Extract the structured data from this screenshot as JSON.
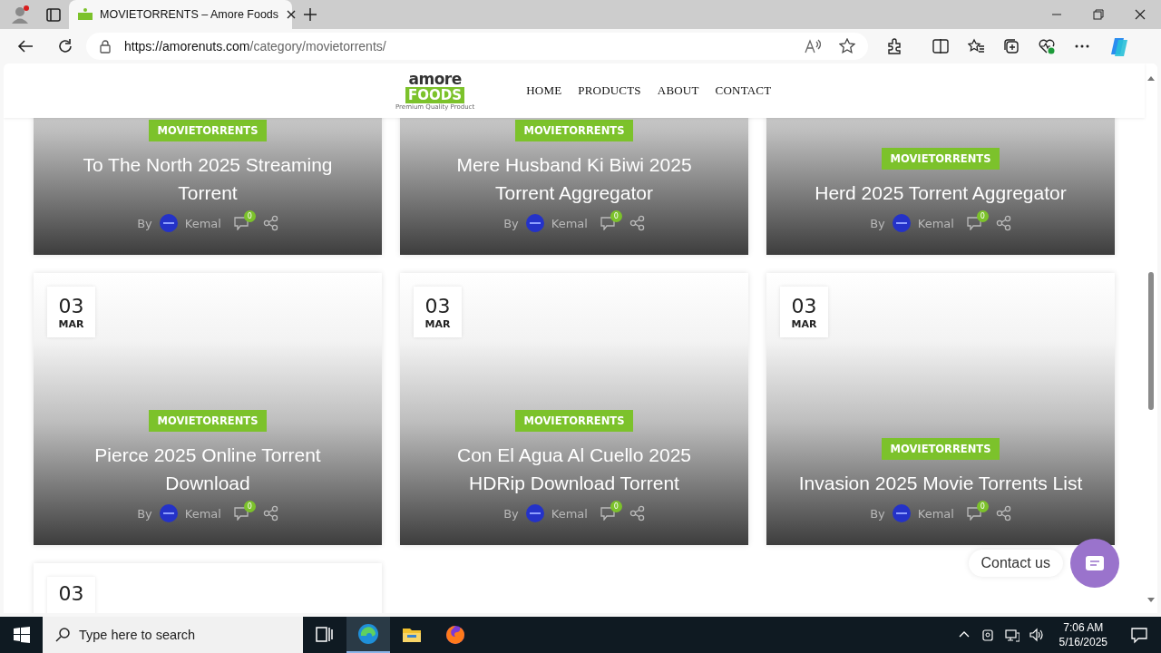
{
  "browser": {
    "tab_title": "MOVIETORRENTS – Amore Foods",
    "url_host": "https://amorenuts.com",
    "url_path": "/category/movietorrents/"
  },
  "site": {
    "logo_word": "amore",
    "logo_band": "FOODS",
    "logo_tagline": "Premium Quality Product",
    "nav": [
      {
        "label": "HOME"
      },
      {
        "label": "PRODUCTS"
      },
      {
        "label": "ABOUT"
      },
      {
        "label": "CONTACT"
      }
    ]
  },
  "posts": [
    {
      "category": "MOVIETORRENTS",
      "title": "To The North 2025 Streaming Torrent",
      "by": "By",
      "author": "Kemal",
      "comments": "0"
    },
    {
      "category": "MOVIETORRENTS",
      "title": "Mere Husband Ki Biwi 2025 Torrent Aggregator",
      "by": "By",
      "author": "Kemal",
      "comments": "0"
    },
    {
      "category": "MOVIETORRENTS",
      "title": "Herd 2025 Torrent Aggregator",
      "by": "By",
      "author": "Kemal",
      "comments": "0"
    },
    {
      "day": "03",
      "month": "MAR",
      "category": "MOVIETORRENTS",
      "title": "Pierce 2025 Online Torrent Download",
      "by": "By",
      "author": "Kemal",
      "comments": "0"
    },
    {
      "day": "03",
      "month": "MAR",
      "category": "MOVIETORRENTS",
      "title": "Con El Agua Al Cuello 2025 HDRip Download Torrent",
      "by": "By",
      "author": "Kemal",
      "comments": "0"
    },
    {
      "day": "03",
      "month": "MAR",
      "category": "MOVIETORRENTS",
      "title": "Invasion 2025 Movie Torrents List",
      "by": "By",
      "author": "Kemal",
      "comments": "0"
    },
    {
      "day": "03"
    }
  ],
  "chat": {
    "label": "Contact us"
  },
  "taskbar": {
    "search_placeholder": "Type here to search",
    "time": "7:06 AM",
    "date": "5/16/2025"
  }
}
